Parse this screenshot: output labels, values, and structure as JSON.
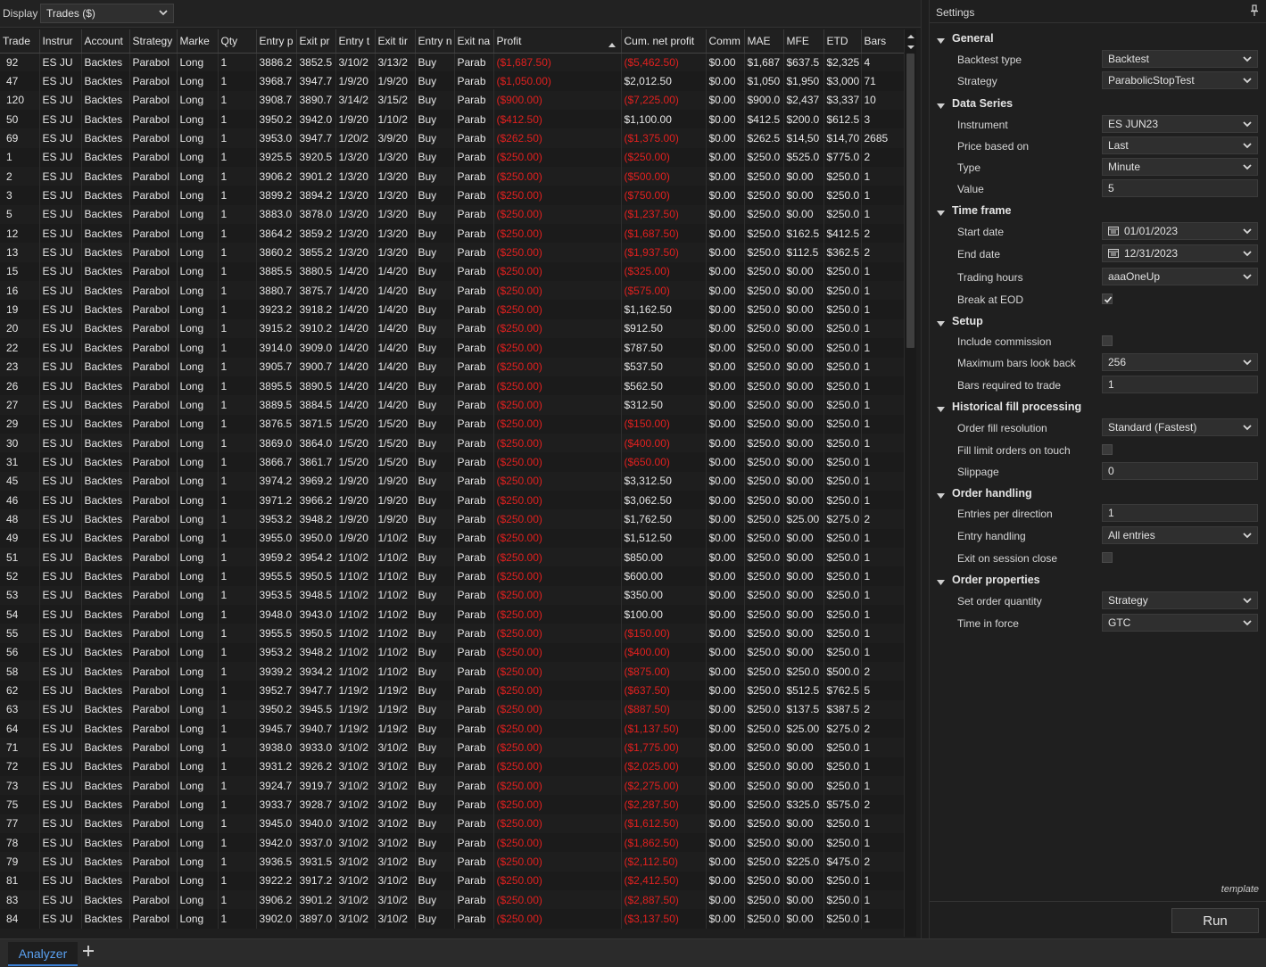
{
  "display": {
    "label": "Display",
    "selected": "Trades ($)"
  },
  "columns": [
    "Trade",
    "Instrur",
    "Account",
    "Strategy",
    "Marke",
    "Qty",
    "Entry p",
    "Exit pr",
    "Entry t",
    "Exit tir",
    "Entry n",
    "Exit na",
    "Profit",
    "Cum. net profit",
    "Comm",
    "MAE",
    "MFE",
    "ETD",
    "Bars"
  ],
  "colors": {
    "negative": "#e0201f",
    "accent": "#3a7fd5",
    "tab_text": "#5aa0f0"
  },
  "rows": [
    [
      "92",
      "ES JU",
      "Backtes",
      "Parabol",
      "Long",
      "1",
      "3886.2",
      "3852.5",
      "3/10/2",
      "3/13/2",
      "Buy",
      "Parab",
      "($1,687.50)",
      "($5,462.50)",
      "$0.00",
      "$1,687",
      "$637.5",
      "$2,325",
      "4"
    ],
    [
      "47",
      "ES JU",
      "Backtes",
      "Parabol",
      "Long",
      "1",
      "3968.7",
      "3947.7",
      "1/9/20",
      "1/9/20",
      "Buy",
      "Parab",
      "($1,050.00)",
      "$2,012.50",
      "$0.00",
      "$1,050",
      "$1,950",
      "$3,000",
      "71"
    ],
    [
      "120",
      "ES JU",
      "Backtes",
      "Parabol",
      "Long",
      "1",
      "3908.7",
      "3890.7",
      "3/14/2",
      "3/15/2",
      "Buy",
      "Parab",
      "($900.00)",
      "($7,225.00)",
      "$0.00",
      "$900.0",
      "$2,437",
      "$3,337",
      "10"
    ],
    [
      "50",
      "ES JU",
      "Backtes",
      "Parabol",
      "Long",
      "1",
      "3950.2",
      "3942.0",
      "1/9/20",
      "1/10/2",
      "Buy",
      "Parab",
      "($412.50)",
      "$1,100.00",
      "$0.00",
      "$412.5",
      "$200.0",
      "$612.5",
      "3"
    ],
    [
      "69",
      "ES JU",
      "Backtes",
      "Parabol",
      "Long",
      "1",
      "3953.0",
      "3947.7",
      "1/20/2",
      "3/9/20",
      "Buy",
      "Parab",
      "($262.50)",
      "($1,375.00)",
      "$0.00",
      "$262.5",
      "$14,50",
      "$14,70",
      "2685"
    ],
    [
      "1",
      "ES JU",
      "Backtes",
      "Parabol",
      "Long",
      "1",
      "3925.5",
      "3920.5",
      "1/3/20",
      "1/3/20",
      "Buy",
      "Parab",
      "($250.00)",
      "($250.00)",
      "$0.00",
      "$250.0",
      "$525.0",
      "$775.0",
      "2"
    ],
    [
      "2",
      "ES JU",
      "Backtes",
      "Parabol",
      "Long",
      "1",
      "3906.2",
      "3901.2",
      "1/3/20",
      "1/3/20",
      "Buy",
      "Parab",
      "($250.00)",
      "($500.00)",
      "$0.00",
      "$250.0",
      "$0.00",
      "$250.0",
      "1"
    ],
    [
      "3",
      "ES JU",
      "Backtes",
      "Parabol",
      "Long",
      "1",
      "3899.2",
      "3894.2",
      "1/3/20",
      "1/3/20",
      "Buy",
      "Parab",
      "($250.00)",
      "($750.00)",
      "$0.00",
      "$250.0",
      "$0.00",
      "$250.0",
      "1"
    ],
    [
      "5",
      "ES JU",
      "Backtes",
      "Parabol",
      "Long",
      "1",
      "3883.0",
      "3878.0",
      "1/3/20",
      "1/3/20",
      "Buy",
      "Parab",
      "($250.00)",
      "($1,237.50)",
      "$0.00",
      "$250.0",
      "$0.00",
      "$250.0",
      "1"
    ],
    [
      "12",
      "ES JU",
      "Backtes",
      "Parabol",
      "Long",
      "1",
      "3864.2",
      "3859.2",
      "1/3/20",
      "1/3/20",
      "Buy",
      "Parab",
      "($250.00)",
      "($1,687.50)",
      "$0.00",
      "$250.0",
      "$162.5",
      "$412.5",
      "2"
    ],
    [
      "13",
      "ES JU",
      "Backtes",
      "Parabol",
      "Long",
      "1",
      "3860.2",
      "3855.2",
      "1/3/20",
      "1/3/20",
      "Buy",
      "Parab",
      "($250.00)",
      "($1,937.50)",
      "$0.00",
      "$250.0",
      "$112.5",
      "$362.5",
      "2"
    ],
    [
      "15",
      "ES JU",
      "Backtes",
      "Parabol",
      "Long",
      "1",
      "3885.5",
      "3880.5",
      "1/4/20",
      "1/4/20",
      "Buy",
      "Parab",
      "($250.00)",
      "($325.00)",
      "$0.00",
      "$250.0",
      "$0.00",
      "$250.0",
      "1"
    ],
    [
      "16",
      "ES JU",
      "Backtes",
      "Parabol",
      "Long",
      "1",
      "3880.7",
      "3875.7",
      "1/4/20",
      "1/4/20",
      "Buy",
      "Parab",
      "($250.00)",
      "($575.00)",
      "$0.00",
      "$250.0",
      "$0.00",
      "$250.0",
      "1"
    ],
    [
      "19",
      "ES JU",
      "Backtes",
      "Parabol",
      "Long",
      "1",
      "3923.2",
      "3918.2",
      "1/4/20",
      "1/4/20",
      "Buy",
      "Parab",
      "($250.00)",
      "$1,162.50",
      "$0.00",
      "$250.0",
      "$0.00",
      "$250.0",
      "1"
    ],
    [
      "20",
      "ES JU",
      "Backtes",
      "Parabol",
      "Long",
      "1",
      "3915.2",
      "3910.2",
      "1/4/20",
      "1/4/20",
      "Buy",
      "Parab",
      "($250.00)",
      "$912.50",
      "$0.00",
      "$250.0",
      "$0.00",
      "$250.0",
      "1"
    ],
    [
      "22",
      "ES JU",
      "Backtes",
      "Parabol",
      "Long",
      "1",
      "3914.0",
      "3909.0",
      "1/4/20",
      "1/4/20",
      "Buy",
      "Parab",
      "($250.00)",
      "$787.50",
      "$0.00",
      "$250.0",
      "$0.00",
      "$250.0",
      "1"
    ],
    [
      "23",
      "ES JU",
      "Backtes",
      "Parabol",
      "Long",
      "1",
      "3905.7",
      "3900.7",
      "1/4/20",
      "1/4/20",
      "Buy",
      "Parab",
      "($250.00)",
      "$537.50",
      "$0.00",
      "$250.0",
      "$0.00",
      "$250.0",
      "1"
    ],
    [
      "26",
      "ES JU",
      "Backtes",
      "Parabol",
      "Long",
      "1",
      "3895.5",
      "3890.5",
      "1/4/20",
      "1/4/20",
      "Buy",
      "Parab",
      "($250.00)",
      "$562.50",
      "$0.00",
      "$250.0",
      "$0.00",
      "$250.0",
      "1"
    ],
    [
      "27",
      "ES JU",
      "Backtes",
      "Parabol",
      "Long",
      "1",
      "3889.5",
      "3884.5",
      "1/4/20",
      "1/4/20",
      "Buy",
      "Parab",
      "($250.00)",
      "$312.50",
      "$0.00",
      "$250.0",
      "$0.00",
      "$250.0",
      "1"
    ],
    [
      "29",
      "ES JU",
      "Backtes",
      "Parabol",
      "Long",
      "1",
      "3876.5",
      "3871.5",
      "1/5/20",
      "1/5/20",
      "Buy",
      "Parab",
      "($250.00)",
      "($150.00)",
      "$0.00",
      "$250.0",
      "$0.00",
      "$250.0",
      "1"
    ],
    [
      "30",
      "ES JU",
      "Backtes",
      "Parabol",
      "Long",
      "1",
      "3869.0",
      "3864.0",
      "1/5/20",
      "1/5/20",
      "Buy",
      "Parab",
      "($250.00)",
      "($400.00)",
      "$0.00",
      "$250.0",
      "$0.00",
      "$250.0",
      "1"
    ],
    [
      "31",
      "ES JU",
      "Backtes",
      "Parabol",
      "Long",
      "1",
      "3866.7",
      "3861.7",
      "1/5/20",
      "1/5/20",
      "Buy",
      "Parab",
      "($250.00)",
      "($650.00)",
      "$0.00",
      "$250.0",
      "$0.00",
      "$250.0",
      "1"
    ],
    [
      "45",
      "ES JU",
      "Backtes",
      "Parabol",
      "Long",
      "1",
      "3974.2",
      "3969.2",
      "1/9/20",
      "1/9/20",
      "Buy",
      "Parab",
      "($250.00)",
      "$3,312.50",
      "$0.00",
      "$250.0",
      "$0.00",
      "$250.0",
      "1"
    ],
    [
      "46",
      "ES JU",
      "Backtes",
      "Parabol",
      "Long",
      "1",
      "3971.2",
      "3966.2",
      "1/9/20",
      "1/9/20",
      "Buy",
      "Parab",
      "($250.00)",
      "$3,062.50",
      "$0.00",
      "$250.0",
      "$0.00",
      "$250.0",
      "1"
    ],
    [
      "48",
      "ES JU",
      "Backtes",
      "Parabol",
      "Long",
      "1",
      "3953.2",
      "3948.2",
      "1/9/20",
      "1/9/20",
      "Buy",
      "Parab",
      "($250.00)",
      "$1,762.50",
      "$0.00",
      "$250.0",
      "$25.00",
      "$275.0",
      "2"
    ],
    [
      "49",
      "ES JU",
      "Backtes",
      "Parabol",
      "Long",
      "1",
      "3955.0",
      "3950.0",
      "1/9/20",
      "1/10/2",
      "Buy",
      "Parab",
      "($250.00)",
      "$1,512.50",
      "$0.00",
      "$250.0",
      "$0.00",
      "$250.0",
      "1"
    ],
    [
      "51",
      "ES JU",
      "Backtes",
      "Parabol",
      "Long",
      "1",
      "3959.2",
      "3954.2",
      "1/10/2",
      "1/10/2",
      "Buy",
      "Parab",
      "($250.00)",
      "$850.00",
      "$0.00",
      "$250.0",
      "$0.00",
      "$250.0",
      "1"
    ],
    [
      "52",
      "ES JU",
      "Backtes",
      "Parabol",
      "Long",
      "1",
      "3955.5",
      "3950.5",
      "1/10/2",
      "1/10/2",
      "Buy",
      "Parab",
      "($250.00)",
      "$600.00",
      "$0.00",
      "$250.0",
      "$0.00",
      "$250.0",
      "1"
    ],
    [
      "53",
      "ES JU",
      "Backtes",
      "Parabol",
      "Long",
      "1",
      "3953.5",
      "3948.5",
      "1/10/2",
      "1/10/2",
      "Buy",
      "Parab",
      "($250.00)",
      "$350.00",
      "$0.00",
      "$250.0",
      "$0.00",
      "$250.0",
      "1"
    ],
    [
      "54",
      "ES JU",
      "Backtes",
      "Parabol",
      "Long",
      "1",
      "3948.0",
      "3943.0",
      "1/10/2",
      "1/10/2",
      "Buy",
      "Parab",
      "($250.00)",
      "$100.00",
      "$0.00",
      "$250.0",
      "$0.00",
      "$250.0",
      "1"
    ],
    [
      "55",
      "ES JU",
      "Backtes",
      "Parabol",
      "Long",
      "1",
      "3955.5",
      "3950.5",
      "1/10/2",
      "1/10/2",
      "Buy",
      "Parab",
      "($250.00)",
      "($150.00)",
      "$0.00",
      "$250.0",
      "$0.00",
      "$250.0",
      "1"
    ],
    [
      "56",
      "ES JU",
      "Backtes",
      "Parabol",
      "Long",
      "1",
      "3953.2",
      "3948.2",
      "1/10/2",
      "1/10/2",
      "Buy",
      "Parab",
      "($250.00)",
      "($400.00)",
      "$0.00",
      "$250.0",
      "$0.00",
      "$250.0",
      "1"
    ],
    [
      "58",
      "ES JU",
      "Backtes",
      "Parabol",
      "Long",
      "1",
      "3939.2",
      "3934.2",
      "1/10/2",
      "1/10/2",
      "Buy",
      "Parab",
      "($250.00)",
      "($875.00)",
      "$0.00",
      "$250.0",
      "$250.0",
      "$500.0",
      "2"
    ],
    [
      "62",
      "ES JU",
      "Backtes",
      "Parabol",
      "Long",
      "1",
      "3952.7",
      "3947.7",
      "1/19/2",
      "1/19/2",
      "Buy",
      "Parab",
      "($250.00)",
      "($637.50)",
      "$0.00",
      "$250.0",
      "$512.5",
      "$762.5",
      "5"
    ],
    [
      "63",
      "ES JU",
      "Backtes",
      "Parabol",
      "Long",
      "1",
      "3950.2",
      "3945.5",
      "1/19/2",
      "1/19/2",
      "Buy",
      "Parab",
      "($250.00)",
      "($887.50)",
      "$0.00",
      "$250.0",
      "$137.5",
      "$387.5",
      "2"
    ],
    [
      "64",
      "ES JU",
      "Backtes",
      "Parabol",
      "Long",
      "1",
      "3945.7",
      "3940.7",
      "1/19/2",
      "1/19/2",
      "Buy",
      "Parab",
      "($250.00)",
      "($1,137.50)",
      "$0.00",
      "$250.0",
      "$25.00",
      "$275.0",
      "2"
    ],
    [
      "71",
      "ES JU",
      "Backtes",
      "Parabol",
      "Long",
      "1",
      "3938.0",
      "3933.0",
      "3/10/2",
      "3/10/2",
      "Buy",
      "Parab",
      "($250.00)",
      "($1,775.00)",
      "$0.00",
      "$250.0",
      "$0.00",
      "$250.0",
      "1"
    ],
    [
      "72",
      "ES JU",
      "Backtes",
      "Parabol",
      "Long",
      "1",
      "3931.2",
      "3926.2",
      "3/10/2",
      "3/10/2",
      "Buy",
      "Parab",
      "($250.00)",
      "($2,025.00)",
      "$0.00",
      "$250.0",
      "$0.00",
      "$250.0",
      "1"
    ],
    [
      "73",
      "ES JU",
      "Backtes",
      "Parabol",
      "Long",
      "1",
      "3924.7",
      "3919.7",
      "3/10/2",
      "3/10/2",
      "Buy",
      "Parab",
      "($250.00)",
      "($2,275.00)",
      "$0.00",
      "$250.0",
      "$0.00",
      "$250.0",
      "1"
    ],
    [
      "75",
      "ES JU",
      "Backtes",
      "Parabol",
      "Long",
      "1",
      "3933.7",
      "3928.7",
      "3/10/2",
      "3/10/2",
      "Buy",
      "Parab",
      "($250.00)",
      "($2,287.50)",
      "$0.00",
      "$250.0",
      "$325.0",
      "$575.0",
      "2"
    ],
    [
      "77",
      "ES JU",
      "Backtes",
      "Parabol",
      "Long",
      "1",
      "3945.0",
      "3940.0",
      "3/10/2",
      "3/10/2",
      "Buy",
      "Parab",
      "($250.00)",
      "($1,612.50)",
      "$0.00",
      "$250.0",
      "$0.00",
      "$250.0",
      "1"
    ],
    [
      "78",
      "ES JU",
      "Backtes",
      "Parabol",
      "Long",
      "1",
      "3942.0",
      "3937.0",
      "3/10/2",
      "3/10/2",
      "Buy",
      "Parab",
      "($250.00)",
      "($1,862.50)",
      "$0.00",
      "$250.0",
      "$0.00",
      "$250.0",
      "1"
    ],
    [
      "79",
      "ES JU",
      "Backtes",
      "Parabol",
      "Long",
      "1",
      "3936.5",
      "3931.5",
      "3/10/2",
      "3/10/2",
      "Buy",
      "Parab",
      "($250.00)",
      "($2,112.50)",
      "$0.00",
      "$250.0",
      "$225.0",
      "$475.0",
      "2"
    ],
    [
      "81",
      "ES JU",
      "Backtes",
      "Parabol",
      "Long",
      "1",
      "3922.2",
      "3917.2",
      "3/10/2",
      "3/10/2",
      "Buy",
      "Parab",
      "($250.00)",
      "($2,412.50)",
      "$0.00",
      "$250.0",
      "$0.00",
      "$250.0",
      "1"
    ],
    [
      "83",
      "ES JU",
      "Backtes",
      "Parabol",
      "Long",
      "1",
      "3906.2",
      "3901.2",
      "3/10/2",
      "3/10/2",
      "Buy",
      "Parab",
      "($250.00)",
      "($2,887.50)",
      "$0.00",
      "$250.0",
      "$0.00",
      "$250.0",
      "1"
    ],
    [
      "84",
      "ES JU",
      "Backtes",
      "Parabol",
      "Long",
      "1",
      "3902.0",
      "3897.0",
      "3/10/2",
      "3/10/2",
      "Buy",
      "Parab",
      "($250.00)",
      "($3,137.50)",
      "$0.00",
      "$250.0",
      "$0.00",
      "$250.0",
      "1"
    ]
  ],
  "settings": {
    "title": "Settings",
    "items": [
      {
        "kind": "group",
        "label": "General"
      },
      {
        "kind": "select",
        "label": "Backtest type",
        "value": "Backtest"
      },
      {
        "kind": "select",
        "label": "Strategy",
        "value": "ParabolicStopTest"
      },
      {
        "kind": "group",
        "label": "Data Series"
      },
      {
        "kind": "select",
        "label": "Instrument",
        "value": "ES JUN23"
      },
      {
        "kind": "select",
        "label": "Price based on",
        "value": "Last"
      },
      {
        "kind": "select",
        "label": "Type",
        "value": "Minute"
      },
      {
        "kind": "text",
        "label": "Value",
        "value": "5"
      },
      {
        "kind": "group",
        "label": "Time frame"
      },
      {
        "kind": "date",
        "label": "Start date",
        "value": "01/01/2023"
      },
      {
        "kind": "date",
        "label": "End date",
        "value": "12/31/2023"
      },
      {
        "kind": "select",
        "label": "Trading hours",
        "value": "aaaOneUp"
      },
      {
        "kind": "check",
        "label": "Break at EOD",
        "value": true
      },
      {
        "kind": "group",
        "label": "Setup"
      },
      {
        "kind": "check",
        "label": "Include commission",
        "value": false
      },
      {
        "kind": "select",
        "label": "Maximum bars look back",
        "value": "256"
      },
      {
        "kind": "text",
        "label": "Bars required to trade",
        "value": "1"
      },
      {
        "kind": "group",
        "label": "Historical fill processing"
      },
      {
        "kind": "select",
        "label": "Order fill resolution",
        "value": "Standard (Fastest)"
      },
      {
        "kind": "check",
        "label": "Fill limit orders on touch",
        "value": false
      },
      {
        "kind": "text",
        "label": "Slippage",
        "value": "0"
      },
      {
        "kind": "group",
        "label": "Order handling"
      },
      {
        "kind": "text",
        "label": "Entries per direction",
        "value": "1"
      },
      {
        "kind": "select",
        "label": "Entry handling",
        "value": "All entries"
      },
      {
        "kind": "check",
        "label": "Exit on session close",
        "value": false
      },
      {
        "kind": "group",
        "label": "Order properties"
      },
      {
        "kind": "select",
        "label": "Set order quantity",
        "value": "Strategy"
      },
      {
        "kind": "select",
        "label": "Time in force",
        "value": "GTC"
      }
    ],
    "template_label": "template",
    "run_label": "Run"
  },
  "tabs": {
    "active": "Analyzer",
    "add": "+"
  },
  "icons": {
    "dropdown": "chevron-down-icon",
    "calendar": "calendar-icon",
    "pin": "pin-icon",
    "collapse": "triangle-down-icon",
    "sort": "sort-asc-icon",
    "check": "checkmark-icon"
  }
}
